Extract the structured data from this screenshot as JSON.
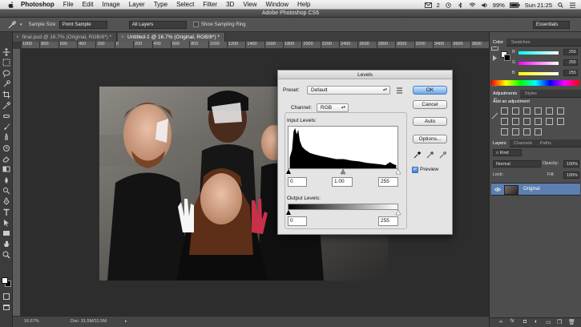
{
  "menubar": {
    "app": "Photoshop",
    "menus": [
      "File",
      "Edit",
      "Image",
      "Layer",
      "Type",
      "Select",
      "Filter",
      "3D",
      "View",
      "Window",
      "Help"
    ],
    "tray_badge": "2",
    "battery": "99%",
    "clock": "Sun 21:25"
  },
  "window_title": "Adobe Photoshop CS6",
  "options": {
    "sample_size_label": "Sample Size:",
    "sample_size_value": "Point Sample",
    "sample_value": "All Layers",
    "show_ring_label": "Show Sampling Ring",
    "workspace": "Essentials"
  },
  "tabs": [
    {
      "label": "final.psd @ 16.7% (Original, RGB/8*) *"
    },
    {
      "label": "Untitled-1 @ 16.7% (Original, RGB/8*) *"
    }
  ],
  "ruler_labels": [
    "1000",
    "800",
    "600",
    "400",
    "200",
    "0",
    "200",
    "400",
    "600",
    "800",
    "1000",
    "1200",
    "1400",
    "1600",
    "1800",
    "2000",
    "2200",
    "2400",
    "2600",
    "2800",
    "3000",
    "3200",
    "3400",
    "3600",
    "3800"
  ],
  "status": {
    "zoom": "16.67%",
    "doc": "Doc: 31.5M/31.5M"
  },
  "color_panel": {
    "tabs": [
      "Color",
      "Swatches"
    ],
    "channels": [
      {
        "label": "R",
        "value": "255"
      },
      {
        "label": "G",
        "value": "255"
      },
      {
        "label": "B",
        "value": "255"
      }
    ]
  },
  "adjustments_panel": {
    "tabs": [
      "Adjustments",
      "Styles"
    ],
    "heading": "Add an adjustment"
  },
  "layers_panel": {
    "tabs": [
      "Layers",
      "Channels",
      "Paths"
    ],
    "kind": "Kind",
    "blend_mode": "Normal",
    "opacity_label": "Opacity:",
    "opacity_value": "100%",
    "lock_label": "Lock:",
    "fill_label": "Fill:",
    "fill_value": "100%",
    "layers": [
      {
        "name": "Original"
      }
    ]
  },
  "levels_dialog": {
    "title": "Levels",
    "preset_label": "Preset:",
    "preset_value": "Default",
    "channel_label": "Channel:",
    "channel_value": "RGB",
    "input_label": "Input Levels:",
    "input_black": "0",
    "input_gamma": "1.00",
    "input_white": "255",
    "output_label": "Output Levels:",
    "output_black": "0",
    "output_white": "255",
    "buttons": {
      "ok": "OK",
      "cancel": "Cancel",
      "auto": "Auto",
      "options": "Options..."
    },
    "preview_label": "Preview",
    "preview_checked": true
  },
  "colors": {
    "accent": "#5b9be0",
    "histogram": "#000000"
  }
}
